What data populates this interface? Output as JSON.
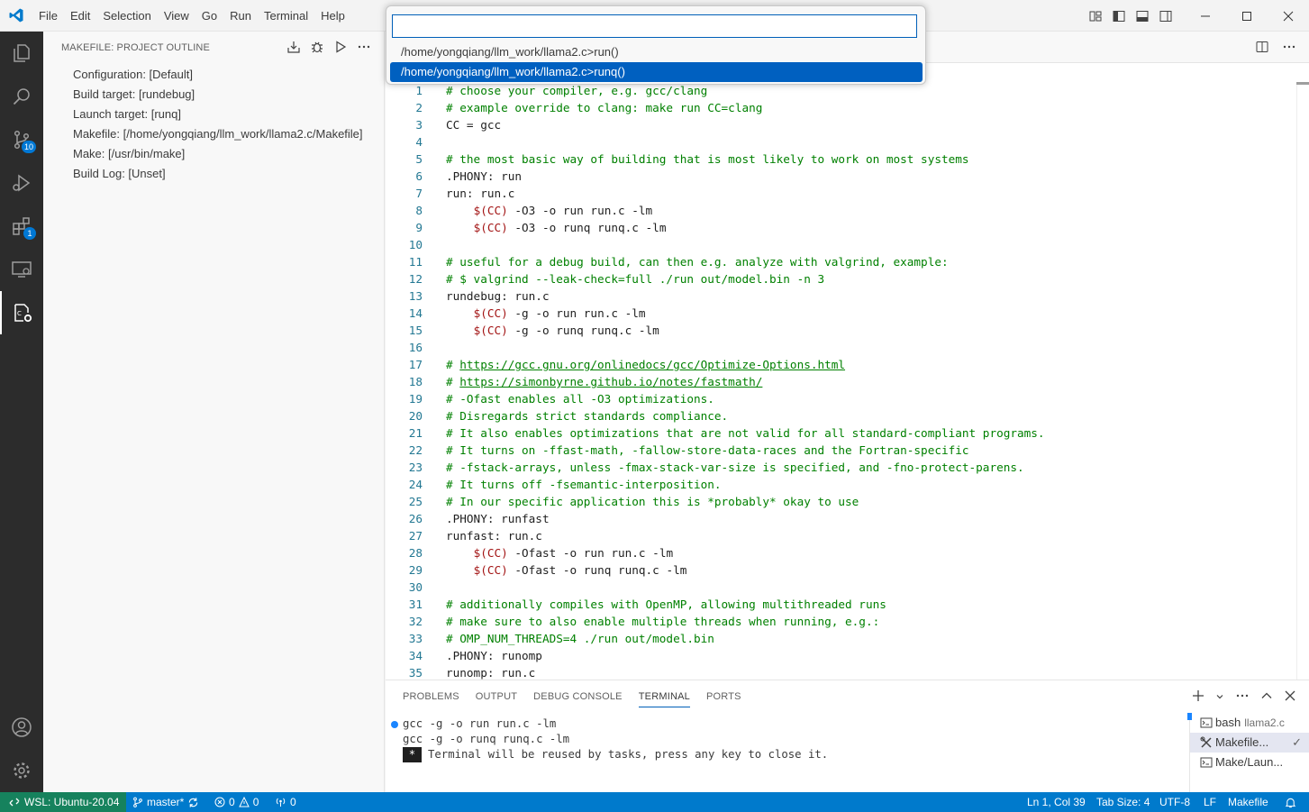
{
  "menu": [
    "File",
    "Edit",
    "Selection",
    "View",
    "Go",
    "Run",
    "Terminal",
    "Help"
  ],
  "sidebar": {
    "title": "MAKEFILE: PROJECT OUTLINE",
    "items": [
      "Configuration: [Default]",
      "Build target: [rundebug]",
      "Launch target: [runq]",
      "Makefile: [/home/yongqiang/llm_work/llama2.c/Makefile]",
      "Make: [/usr/bin/make]",
      "Build Log: [Unset]"
    ]
  },
  "activity": {
    "scm_badge": "10",
    "extensions_badge": "1"
  },
  "quickpick": {
    "input_value": "",
    "items": [
      "/home/yongqiang/llm_work/llama2.c>run()",
      "/home/yongqiang/llm_work/llama2.c>runq()"
    ],
    "selected_index": 1
  },
  "code": [
    {
      "n": "1",
      "parts": [
        {
          "t": "# choose your compiler, e.g. gcc/clang",
          "c": "c"
        }
      ]
    },
    {
      "n": "2",
      "parts": [
        {
          "t": "# example override to clang: make run CC=clang",
          "c": "c"
        }
      ]
    },
    {
      "n": "3",
      "parts": [
        {
          "t": "CC = gcc",
          "c": ""
        }
      ]
    },
    {
      "n": "4",
      "parts": []
    },
    {
      "n": "5",
      "parts": [
        {
          "t": "# the most basic way of building that is most likely to work on most systems",
          "c": "c"
        }
      ]
    },
    {
      "n": "6",
      "parts": [
        {
          "t": ".PHONY: run",
          "c": ""
        }
      ]
    },
    {
      "n": "7",
      "parts": [
        {
          "t": "run: run.c",
          "c": ""
        }
      ]
    },
    {
      "n": "8",
      "parts": [
        {
          "t": "    ",
          "c": ""
        },
        {
          "t": "$(CC)",
          "c": "v"
        },
        {
          "t": " -O3 -o run run.c -lm",
          "c": ""
        }
      ]
    },
    {
      "n": "9",
      "parts": [
        {
          "t": "    ",
          "c": ""
        },
        {
          "t": "$(CC)",
          "c": "v"
        },
        {
          "t": " -O3 -o runq runq.c -lm",
          "c": ""
        }
      ]
    },
    {
      "n": "10",
      "parts": []
    },
    {
      "n": "11",
      "parts": [
        {
          "t": "# useful for a debug build, can then e.g. analyze with valgrind, example:",
          "c": "c"
        }
      ]
    },
    {
      "n": "12",
      "parts": [
        {
          "t": "# $ valgrind --leak-check=full ./run out/model.bin -n 3",
          "c": "c"
        }
      ]
    },
    {
      "n": "13",
      "parts": [
        {
          "t": "rundebug: run.c",
          "c": ""
        }
      ]
    },
    {
      "n": "14",
      "parts": [
        {
          "t": "    ",
          "c": ""
        },
        {
          "t": "$(CC)",
          "c": "v"
        },
        {
          "t": " -g -o run run.c -lm",
          "c": ""
        }
      ]
    },
    {
      "n": "15",
      "parts": [
        {
          "t": "    ",
          "c": ""
        },
        {
          "t": "$(CC)",
          "c": "v"
        },
        {
          "t": " -g -o runq runq.c -lm",
          "c": ""
        }
      ]
    },
    {
      "n": "16",
      "parts": []
    },
    {
      "n": "17",
      "parts": [
        {
          "t": "# ",
          "c": "c"
        },
        {
          "t": "https://gcc.gnu.org/onlinedocs/gcc/Optimize-Options.html",
          "c": "c link"
        }
      ]
    },
    {
      "n": "18",
      "parts": [
        {
          "t": "# ",
          "c": "c"
        },
        {
          "t": "https://simonbyrne.github.io/notes/fastmath/",
          "c": "c link"
        }
      ]
    },
    {
      "n": "19",
      "parts": [
        {
          "t": "# -Ofast enables all -O3 optimizations.",
          "c": "c"
        }
      ]
    },
    {
      "n": "20",
      "parts": [
        {
          "t": "# Disregards strict standards compliance.",
          "c": "c"
        }
      ]
    },
    {
      "n": "21",
      "parts": [
        {
          "t": "# It also enables optimizations that are not valid for all standard-compliant programs.",
          "c": "c"
        }
      ]
    },
    {
      "n": "22",
      "parts": [
        {
          "t": "# It turns on -ffast-math, -fallow-store-data-races and the Fortran-specific",
          "c": "c"
        }
      ]
    },
    {
      "n": "23",
      "parts": [
        {
          "t": "# -fstack-arrays, unless -fmax-stack-var-size is specified, and -fno-protect-parens.",
          "c": "c"
        }
      ]
    },
    {
      "n": "24",
      "parts": [
        {
          "t": "# It turns off -fsemantic-interposition.",
          "c": "c"
        }
      ]
    },
    {
      "n": "25",
      "parts": [
        {
          "t": "# In our specific application this is *probably* okay to use",
          "c": "c"
        }
      ]
    },
    {
      "n": "26",
      "parts": [
        {
          "t": ".PHONY: runfast",
          "c": ""
        }
      ]
    },
    {
      "n": "27",
      "parts": [
        {
          "t": "runfast: run.c",
          "c": ""
        }
      ]
    },
    {
      "n": "28",
      "parts": [
        {
          "t": "    ",
          "c": ""
        },
        {
          "t": "$(CC)",
          "c": "v"
        },
        {
          "t": " -Ofast -o run run.c -lm",
          "c": ""
        }
      ]
    },
    {
      "n": "29",
      "parts": [
        {
          "t": "    ",
          "c": ""
        },
        {
          "t": "$(CC)",
          "c": "v"
        },
        {
          "t": " -Ofast -o runq runq.c -lm",
          "c": ""
        }
      ]
    },
    {
      "n": "30",
      "parts": []
    },
    {
      "n": "31",
      "parts": [
        {
          "t": "# additionally compiles with OpenMP, allowing multithreaded runs",
          "c": "c"
        }
      ]
    },
    {
      "n": "32",
      "parts": [
        {
          "t": "# make sure to also enable multiple threads when running, e.g.:",
          "c": "c"
        }
      ]
    },
    {
      "n": "33",
      "parts": [
        {
          "t": "# OMP_NUM_THREADS=4 ./run out/model.bin",
          "c": "c"
        }
      ]
    },
    {
      "n": "34",
      "parts": [
        {
          "t": ".PHONY: runomp",
          "c": ""
        }
      ]
    },
    {
      "n": "35",
      "parts": [
        {
          "t": "runomp: run.c",
          "c": ""
        }
      ]
    }
  ],
  "panel": {
    "tabs": [
      "PROBLEMS",
      "OUTPUT",
      "DEBUG CONSOLE",
      "TERMINAL",
      "PORTS"
    ],
    "active_tab": "TERMINAL",
    "terminal_lines": [
      "gcc -g -o run run.c -lm",
      "gcc -g -o runq runq.c -lm"
    ],
    "terminal_star": "*",
    "terminal_notice": "Terminal will be reused by tasks, press any key to close it.",
    "terminals": [
      {
        "name": "bash",
        "sub": "llama2.c"
      },
      {
        "name": "Makefile...",
        "sub": ""
      },
      {
        "name": "Make/Laun...",
        "sub": ""
      }
    ]
  },
  "status": {
    "remote": "WSL: Ubuntu-20.04",
    "branch": "master*",
    "errors": "0",
    "warnings": "0",
    "ports": "0",
    "position": "Ln 1, Col 39",
    "tab_size": "Tab Size: 4",
    "encoding": "UTF-8",
    "eol": "LF",
    "language": "Makefile"
  },
  "colors": {
    "accent": "#007acc",
    "remote": "#16825d",
    "selection": "#0060c0",
    "comment": "#008000",
    "variable": "#a31515"
  }
}
